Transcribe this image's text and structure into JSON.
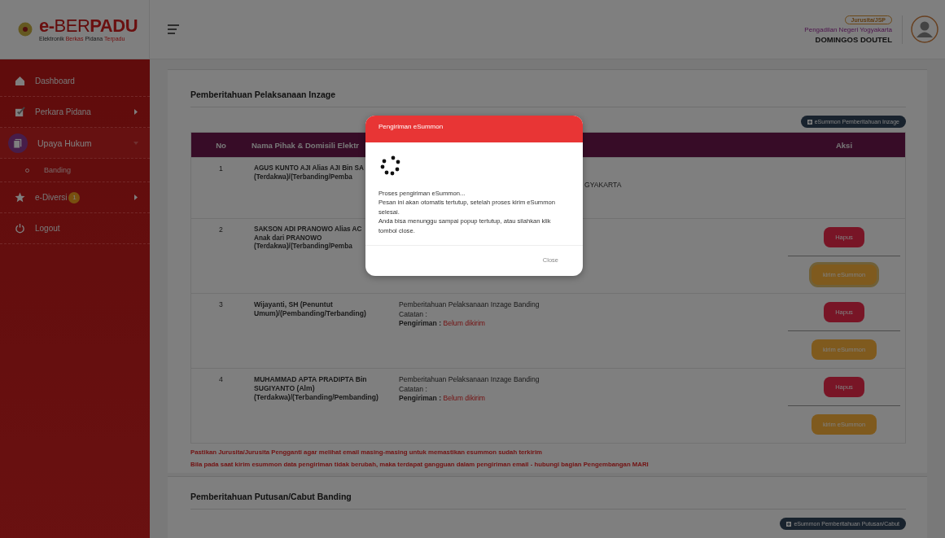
{
  "header": {
    "logo": [
      {
        "text": "e-",
        "accent": true
      },
      {
        "text": "BER",
        "accent": false
      },
      {
        "text": "PADU",
        "accent": true
      }
    ],
    "tagline": [
      {
        "text": "Elektronik ",
        "accent": false
      },
      {
        "text": "Berkas",
        "accent": true
      },
      {
        "text": " Pidana ",
        "accent": false
      },
      {
        "text": "Terpadu",
        "accent": true
      }
    ],
    "user": {
      "role": "Jurusita/JSP",
      "court": "Pengadilan Negeri Yogyakarta",
      "name": "DOMINGOS DOUTEL"
    }
  },
  "sidebar": {
    "items": [
      {
        "kind": "link",
        "label": "Dashboard",
        "selected": false
      },
      {
        "kind": "menu",
        "label": "Perkara Pidana",
        "selected": false,
        "expanded": false
      },
      {
        "kind": "menu",
        "label": "Upaya Hukum",
        "selected": true,
        "expanded": true,
        "children": [
          {
            "label": "Banding",
            "selected": false
          }
        ]
      },
      {
        "kind": "menu",
        "label": "e-Diversi",
        "selected": false,
        "expanded": false,
        "badge": "1"
      },
      {
        "kind": "link",
        "label": "Logout",
        "selected": false
      }
    ]
  },
  "sections": [
    {
      "title": "Pemberitahuan Pelaksanaan Inzage",
      "button": "eSummon Pemberitahuan Inzage",
      "table": {
        "columns": [
          "No",
          "Nama Pihak & Domisili Elektr",
          "Aksi"
        ],
        "rows": [
          {
            "no": "1",
            "name": [
              "AGUS KUNTO AJI Alias AJI Bin SA",
              "(Terdakwa)/(Terbanding/Pemba"
            ],
            "detail_fragment": "GYAKARTA",
            "actions": []
          },
          {
            "no": "2",
            "name": [
              "SAKSON ADI PRANOWO Alias AC",
              "Anak dari PRANOWO",
              "(Terdakwa)/(Terbanding/Pemba"
            ],
            "actions": [
              {
                "kind": "delete",
                "label": "Hapus",
                "focused": false
              },
              {
                "kind": "send",
                "label": "kirim eSummon",
                "focused": true
              }
            ]
          },
          {
            "no": "3",
            "name": [
              "Wijayanti, SH (Penuntut Umum)/(Pembanding/Terbanding)"
            ],
            "detail": {
              "notice": "Pemberitahuan Pelaksanaan Inzage Banding",
              "note_label": "Catatan :",
              "sent_label": "Pengiriman :",
              "sent_status": "Belum dikirim"
            },
            "actions": [
              {
                "kind": "delete",
                "label": "Hapus",
                "focused": false
              },
              {
                "kind": "send",
                "label": "kirim eSummon",
                "focused": false
              }
            ]
          },
          {
            "no": "4",
            "name": [
              "MUHAMMAD APTA PRADIPTA Bin SUGIYANTO (Alm) (Terdakwa)/(Terbanding/Pembanding)"
            ],
            "detail": {
              "notice": "Pemberitahuan Pelaksanaan Inzage Banding",
              "note_label": "Catatan :",
              "sent_label": "Pengiriman :",
              "sent_status": "Belum dikirim"
            },
            "actions": [
              {
                "kind": "delete",
                "label": "Hapus",
                "focused": false
              },
              {
                "kind": "send",
                "label": "kirim eSummon",
                "focused": false
              }
            ]
          }
        ]
      },
      "notes": [
        "Pastikan Jurusita/Jurusita Pengganti agar melihat email masing-masing untuk memastikan esummon sudah terkirim",
        "Bila pada saat kirim esummon data pengiriman tidak berubah, maka terdapat gangguan dalam pengiriman email - hubungi bagian Pengembangan MARI"
      ]
    },
    {
      "title": "Pemberitahuan Putusan/Cabut Banding",
      "button": "eSummon Pemberitahuan Putusan/Cabut"
    }
  ],
  "modal": {
    "title": "Pengiriman eSummon",
    "lines": [
      "Proses pengiriman eSummon...",
      "Pesan ini akan otomatis tertutup, setelah proses kirim eSummon selesai.",
      "Anda bisa menunggu sampai popup tertutup, atau silahkan klik tombol close."
    ],
    "close": "Close"
  }
}
